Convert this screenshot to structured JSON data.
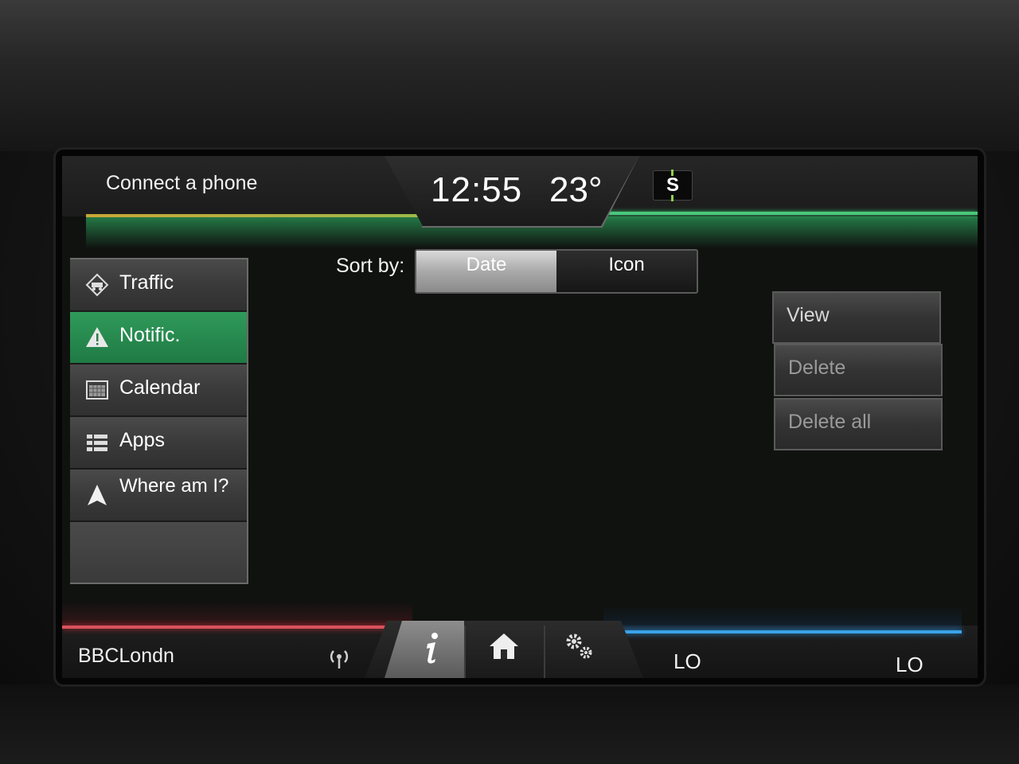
{
  "status_bar": {
    "phone_text": "Connect a phone",
    "time": "12:55",
    "temperature": "23°",
    "badge": "S"
  },
  "side_menu": {
    "items": [
      {
        "label": "Traffic",
        "icon": "traffic-icon",
        "active": false
      },
      {
        "label": "Notific.",
        "icon": "warning-icon",
        "active": true
      },
      {
        "label": "Calendar",
        "icon": "calendar-icon",
        "active": false
      },
      {
        "label": "Apps",
        "icon": "apps-list-icon",
        "active": false
      },
      {
        "label": "Where am I?",
        "icon": "navigation-arrow-icon",
        "active": false
      }
    ]
  },
  "sort": {
    "label": "Sort by:",
    "options": [
      "Date",
      "Icon"
    ],
    "selected": "Date"
  },
  "actions": {
    "view": "View",
    "delete": "Delete",
    "delete_all": "Delete all"
  },
  "bottom_bar": {
    "station": "BBCLondn",
    "left_temp": "LO",
    "right_temp": "LO",
    "nav_icons": [
      "info-icon",
      "home-icon",
      "settings-gears-icon"
    ]
  },
  "colors": {
    "accent_green": "#2f9a5a",
    "accent_red": "#d8525c",
    "accent_blue": "#3aa3e8"
  }
}
